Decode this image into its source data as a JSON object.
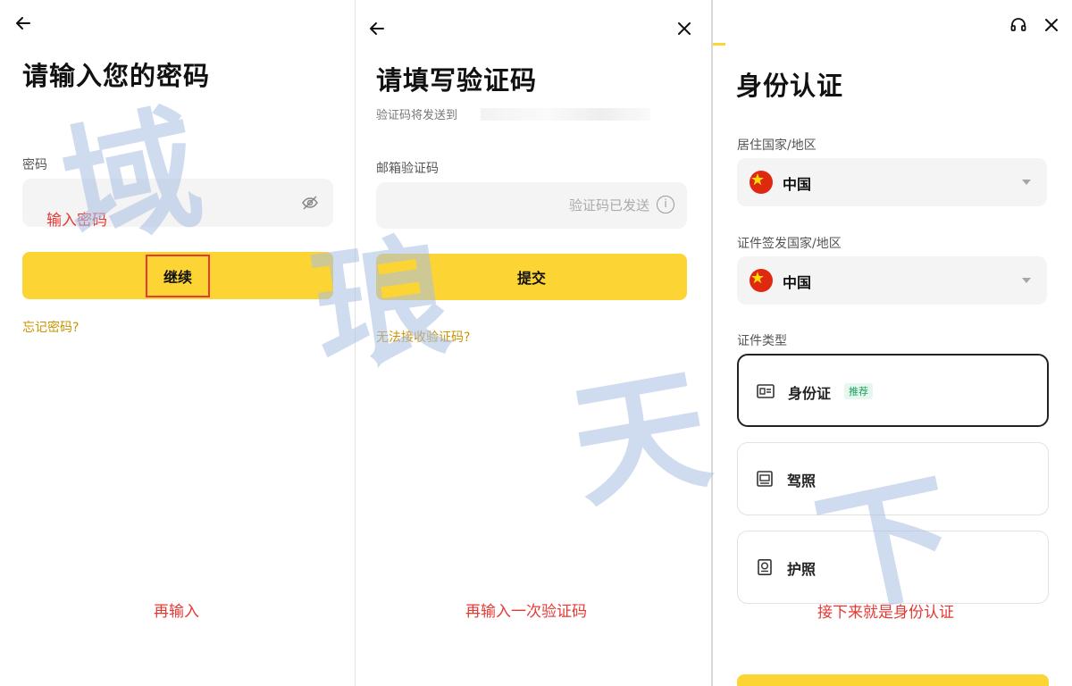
{
  "panel1": {
    "title": "请输入您的密码",
    "password_label": "密码",
    "password_placeholder": "输入密码",
    "continue_button": "继续",
    "forgot_link": "忘记密码?",
    "note": "再输入"
  },
  "panel2": {
    "title": "请填写验证码",
    "sent_to_label": "验证码将发送到",
    "email_code_label": "邮箱验证码",
    "code_status": "验证码已发送",
    "submit_button": "提交",
    "cannot_receive_link": "无法接收验证码?",
    "note": "再输入一次验证码"
  },
  "panel3": {
    "title": "身份认证",
    "residence_label": "居住国家/地区",
    "residence_value": "中国",
    "issuing_label": "证件签发国家/地区",
    "issuing_value": "中国",
    "doc_type_label": "证件类型",
    "options": [
      {
        "label": "身份证",
        "badge": "推荐"
      },
      {
        "label": "驾照"
      },
      {
        "label": "护照"
      }
    ],
    "note": "接下来就是身份认证"
  },
  "watermark": [
    "域",
    "琅",
    "天",
    "下"
  ],
  "colors": {
    "accent_yellow": "#fcd535",
    "link_gold": "#c99400",
    "note_red": "#e53935",
    "badge_green": "#1aa15c",
    "flag_red": "#de2910"
  }
}
